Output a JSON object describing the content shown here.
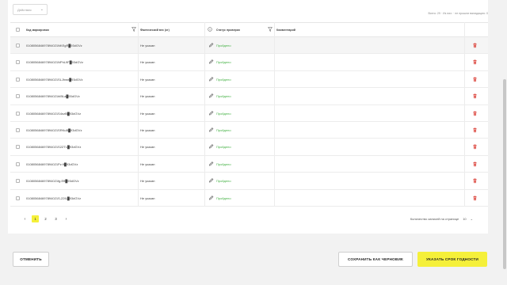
{
  "toolbar": {
    "actions_label": "Действия"
  },
  "summary": {
    "text": "Всего: 29 · Из них: · не прошли валидацию: 0"
  },
  "table": {
    "columns": {
      "code": "Код маркировки",
      "weight": "Фактический вес (кг)",
      "status": "Статус проверки",
      "comment": "Комментарий"
    },
    "rows": [
      {
        "code": "010805684697894021NKEgR█93dGVz",
        "weight": "Не указан",
        "status": "Пройдено"
      },
      {
        "code": "010805684697894021NPhL9F█93dGVz",
        "weight": "Не указан",
        "status": "Пройдено"
      },
      {
        "code": "010805684697894021SLJhwn█93dGVz",
        "weight": "Не указан",
        "status": "Пройдено"
      },
      {
        "code": "010805684697894021hIBLa█93dGVz",
        "weight": "Не указан",
        "status": "Пройдено"
      },
      {
        "code": "010805684697894021S4nzB█93dGVz",
        "weight": "Не указан",
        "status": "Пройдено"
      },
      {
        "code": "010805684697894021SRKuB█93dGVz",
        "weight": "Не указан",
        "status": "Пройдено"
      },
      {
        "code": "010805684697894021S2ZTL█93dGVz",
        "weight": "Не указан",
        "status": "Пройдено"
      },
      {
        "code": "010805684697894021Pz:9█93dGVz",
        "weight": "Не указан",
        "status": "Пройдено"
      },
      {
        "code": "010805684697894021fg.Eft█93dGVz",
        "weight": "Не указан",
        "status": "Пройдено"
      },
      {
        "code": "010805684697894021S-22fL█93dGVz",
        "weight": "Не указан",
        "status": "Пройдено"
      }
    ]
  },
  "pagination": {
    "pages": [
      "1",
      "2",
      "3"
    ],
    "prev": "‹",
    "next": "›"
  },
  "per_page": {
    "label": "Количество записей на странице",
    "value": "10",
    "chevron": "⌄"
  },
  "footer": {
    "cancel": "Отменить",
    "draft": "Сохранить как черновик",
    "primary": "Указать срок годности"
  },
  "colors": {
    "accent": "#f5f03a",
    "success": "#43b143",
    "danger": "#d9342b"
  }
}
